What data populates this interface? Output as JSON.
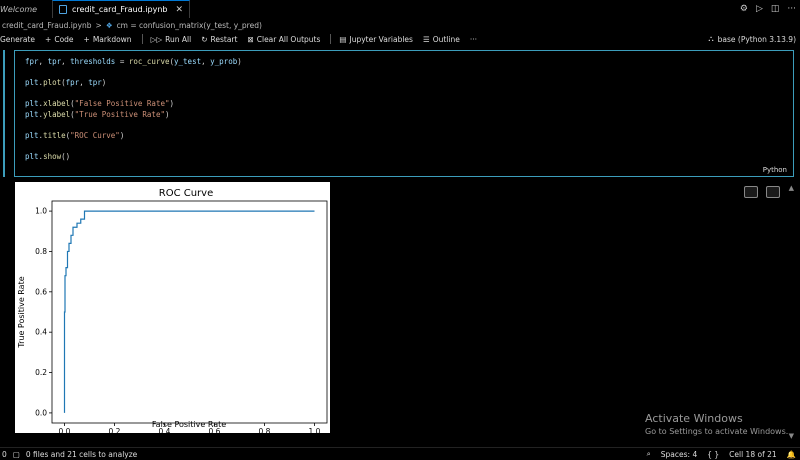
{
  "tabs": [
    {
      "label": "Welcome",
      "active": false
    },
    {
      "label": "credit_card_Fraud.ipynb",
      "active": true
    }
  ],
  "breadcrumb": {
    "file": "credit_card_Fraud.ipynb",
    "separator": ">",
    "symbol": "cm = confusion_matrix(y_test, y_pred)"
  },
  "toolbar": {
    "generate": "Generate",
    "code": "Code",
    "markdown": "Markdown",
    "run_all": "Run All",
    "restart": "Restart",
    "clear_outputs": "Clear All Outputs",
    "variables": "Jupyter Variables",
    "outline": "Outline",
    "more": "···",
    "kernel": "base (Python 3.13.9)"
  },
  "cell": {
    "language": "Python",
    "lines": [
      {
        "tokens": [
          [
            "t-id",
            "fpr"
          ],
          [
            "t-pl",
            ", "
          ],
          [
            "t-id",
            "tpr"
          ],
          [
            "t-pl",
            ", "
          ],
          [
            "t-id",
            "thresholds"
          ],
          [
            "t-pl",
            " = "
          ],
          [
            "t-fn",
            "roc_curve"
          ],
          [
            "t-pl",
            "("
          ],
          [
            "t-id",
            "y_test"
          ],
          [
            "t-pl",
            ", "
          ],
          [
            "t-id",
            "y_prob"
          ],
          [
            "t-pl",
            ")"
          ]
        ]
      },
      {
        "tokens": []
      },
      {
        "tokens": [
          [
            "t-id",
            "plt"
          ],
          [
            "t-pl",
            "."
          ],
          [
            "t-fn",
            "plot"
          ],
          [
            "t-pl",
            "("
          ],
          [
            "t-id",
            "fpr"
          ],
          [
            "t-pl",
            ", "
          ],
          [
            "t-id",
            "tpr"
          ],
          [
            "t-pl",
            ")"
          ]
        ]
      },
      {
        "tokens": []
      },
      {
        "tokens": [
          [
            "t-id",
            "plt"
          ],
          [
            "t-pl",
            "."
          ],
          [
            "t-fn",
            "xlabel"
          ],
          [
            "t-pl",
            "("
          ],
          [
            "t-str",
            "\"False Positive Rate\""
          ],
          [
            "t-pl",
            ")"
          ]
        ]
      },
      {
        "tokens": [
          [
            "t-id",
            "plt"
          ],
          [
            "t-pl",
            "."
          ],
          [
            "t-fn",
            "ylabel"
          ],
          [
            "t-pl",
            "("
          ],
          [
            "t-str",
            "\"True Positive Rate\""
          ],
          [
            "t-pl",
            ")"
          ]
        ]
      },
      {
        "tokens": []
      },
      {
        "tokens": [
          [
            "t-id",
            "plt"
          ],
          [
            "t-pl",
            "."
          ],
          [
            "t-fn",
            "title"
          ],
          [
            "t-pl",
            "("
          ],
          [
            "t-str",
            "\"ROC Curve\""
          ],
          [
            "t-pl",
            ")"
          ]
        ]
      },
      {
        "tokens": []
      },
      {
        "tokens": [
          [
            "t-id",
            "plt"
          ],
          [
            "t-pl",
            "."
          ],
          [
            "t-fn",
            "show"
          ],
          [
            "t-pl",
            "()"
          ]
        ]
      }
    ]
  },
  "chart_data": {
    "type": "line",
    "title": "ROC Curve",
    "xlabel": "False Positive Rate",
    "ylabel": "True Positive Rate",
    "xlim": [
      -0.05,
      1.05
    ],
    "ylim": [
      -0.05,
      1.05
    ],
    "xticks": [
      "0.0",
      "0.2",
      "0.4",
      "0.6",
      "0.8",
      "1.0"
    ],
    "yticks": [
      "0.0",
      "0.2",
      "0.4",
      "0.6",
      "0.8",
      "1.0"
    ],
    "grid": false,
    "color": "#1f77b4",
    "series": [
      {
        "x": [
          0.0,
          0.0,
          0.002,
          0.002,
          0.006,
          0.006,
          0.012,
          0.012,
          0.018,
          0.018,
          0.026,
          0.026,
          0.034,
          0.034,
          0.05,
          0.05,
          0.065,
          0.065,
          0.08,
          0.08,
          1.0
        ],
        "y": [
          0.0,
          0.5,
          0.5,
          0.68,
          0.68,
          0.72,
          0.72,
          0.8,
          0.8,
          0.84,
          0.84,
          0.88,
          0.88,
          0.92,
          0.92,
          0.94,
          0.94,
          0.96,
          0.96,
          1.0,
          1.0
        ]
      }
    ]
  },
  "watermark": {
    "line1": "Activate Windows",
    "line2": "Go to Settings to activate Windows."
  },
  "status": {
    "problems": "0",
    "analysis": "0 files and 21 cells to analyze",
    "spaces": "Spaces: 4",
    "braces": "{ }",
    "cell": "Cell 18 of 21"
  }
}
